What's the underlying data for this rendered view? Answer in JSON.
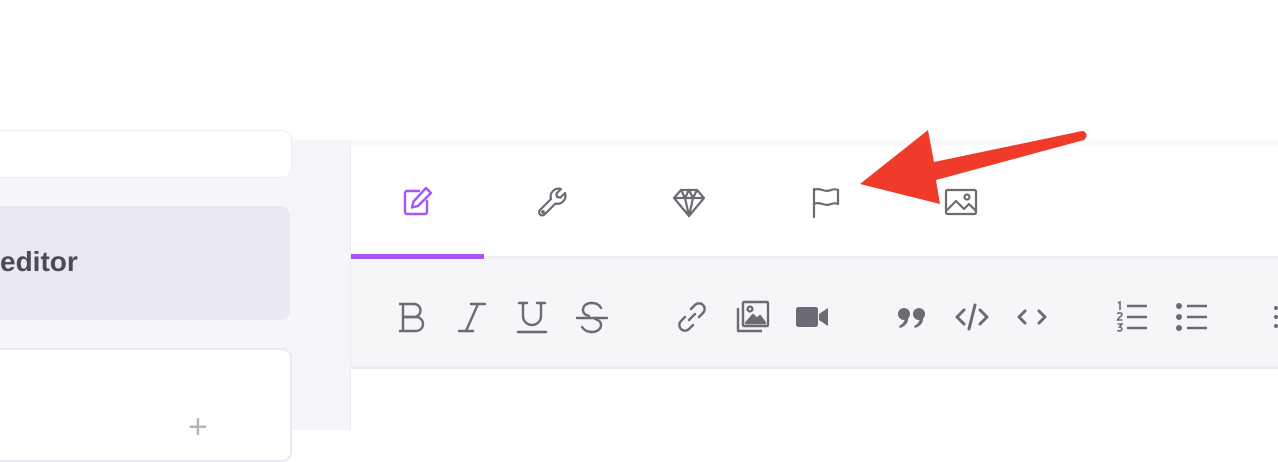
{
  "sidebar": {
    "active_item_label": "editor",
    "add_symbol": "+"
  },
  "editor": {
    "tabs": [
      {
        "name": "edit",
        "icon": "edit-icon",
        "active": true
      },
      {
        "name": "settings",
        "icon": "wrench-icon",
        "active": false
      },
      {
        "name": "premium",
        "icon": "diamond-icon",
        "active": false
      },
      {
        "name": "flag",
        "icon": "flag-icon",
        "active": false
      },
      {
        "name": "image",
        "icon": "image-icon",
        "active": false
      }
    ],
    "toolbar": [
      "bold-icon",
      "italic-icon",
      "underline-icon",
      "strikethrough-icon",
      "link-icon",
      "image-icon",
      "video-icon",
      "quote-icon",
      "code-block-icon",
      "inline-code-icon",
      "ordered-list-icon",
      "bullet-list-icon"
    ]
  },
  "colors": {
    "accent": "#a855f7",
    "annotation_arrow": "#f03a2a",
    "icon": "#6b6b73"
  }
}
